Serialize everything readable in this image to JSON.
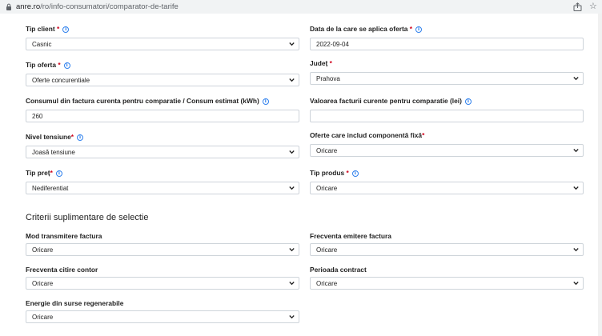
{
  "browser": {
    "url_host": "anre.ro",
    "url_path": "/ro/info-consumatori/comparator-de-tarife"
  },
  "form": {
    "tip_client": {
      "label": "Tip client",
      "value": "Casnic"
    },
    "data_oferta": {
      "label": "Data de la care se aplica oferta",
      "value": "2022-09-04"
    },
    "tip_oferta": {
      "label": "Tip oferta",
      "value": "Oferte concurentiale"
    },
    "judet": {
      "label": "Județ",
      "value": "Prahova"
    },
    "consum": {
      "label": "Consumul din factura curenta pentru comparatie / Consum estimat (kWh)",
      "value": "260"
    },
    "valoare_factura": {
      "label": "Valoarea facturii curente pentru comparatie (lei)",
      "value": ""
    },
    "nivel_tensiune": {
      "label": "Nivel tensiune",
      "value": "Joasă tensiune"
    },
    "componenta_fixa": {
      "label": "Oferte care includ componentă fixă",
      "value": "Oricare"
    },
    "tip_pret": {
      "label": "Tip preț",
      "value": "Nediferentiat"
    },
    "tip_produs": {
      "label": "Tip produs",
      "value": "Oricare"
    }
  },
  "extra": {
    "title": "Criterii suplimentare de selectie",
    "mod_transmitere": {
      "label": "Mod transmitere factura",
      "value": "Oricare"
    },
    "frecventa_emitere": {
      "label": "Frecventa emitere factura",
      "value": "Oricare"
    },
    "frecventa_citire": {
      "label": "Frecventa citire contor",
      "value": "Oricare"
    },
    "perioada_contract": {
      "label": "Perioada contract",
      "value": "Oricare"
    },
    "energie_regenerabila": {
      "label": "Energie din surse regenerabile",
      "value": "Oricare"
    }
  },
  "colors": {
    "required": "#d0021b",
    "info": "#2f80ed",
    "border": "#ced4da"
  },
  "required_mark": "*",
  "info_glyph": "i",
  "icons": [
    "lock-icon",
    "share-icon",
    "star-icon",
    "info-icon",
    "chevron-down-icon"
  ]
}
